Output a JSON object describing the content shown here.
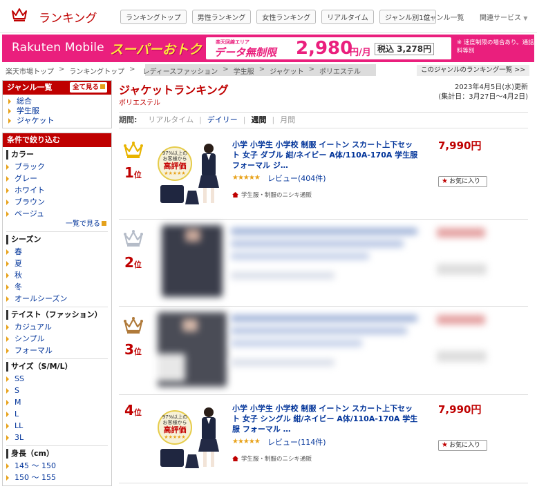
{
  "header": {
    "title": "ランキング",
    "tabs": [
      "ランキングトップ",
      "男性ランキング",
      "女性ランキング",
      "リアルタイム",
      "ジャンル別1位"
    ],
    "genre_list": "ジャンル一覧",
    "related": "関連サービス"
  },
  "banner": {
    "logo": "Rakuten Mobile",
    "headline": "スーパーおトク",
    "area": "楽天回線エリア",
    "data": "データ無制限",
    "price": "2,980",
    "unit": "円/月",
    "tax": "税込 3,278円",
    "note": "※ 速度制限の場合あり。通話料等別"
  },
  "breadcrumb": {
    "items": [
      "楽天市場トップ",
      "ランキングトップ",
      "レディースファッション",
      "学生服",
      "ジャケット",
      "ポリエステル"
    ],
    "right": "このジャンルのランキング一覧 >>"
  },
  "sidebar": {
    "genre_head": "ジャンル一覧",
    "all_btn": "全て見る",
    "genres": [
      "総合",
      "学生服",
      "ジャケット"
    ],
    "filter_head": "条件で絞り込む",
    "sections": [
      {
        "title": "カラー",
        "items": [
          "ブラック",
          "グレー",
          "ホワイト",
          "ブラウン",
          "ベージュ"
        ],
        "more": "一覧で見る"
      },
      {
        "title": "シーズン",
        "items": [
          "春",
          "夏",
          "秋",
          "冬",
          "オールシーズン"
        ]
      },
      {
        "title": "テイスト（ファッション）",
        "items": [
          "カジュアル",
          "シンプル",
          "フォーマル"
        ]
      },
      {
        "title": "サイズ（S/M/L）",
        "items": [
          "SS",
          "S",
          "M",
          "L",
          "LL",
          "3L"
        ]
      },
      {
        "title": "身長（cm）",
        "items": [
          "145 ～ 150",
          "150 ～ 155"
        ]
      }
    ]
  },
  "main": {
    "title": "ジャケットランキング",
    "subtitle": "ポリエステル",
    "updated": "2023年4月5日(水)更新",
    "period_range": "(集計日：3月27日～4月2日)",
    "period_label": "期間:",
    "periods": [
      "リアルタイム",
      "デイリー",
      "週間",
      "月間"
    ],
    "active_period": "週間"
  },
  "products": [
    {
      "rank": "1",
      "rank_suffix": "位",
      "name": "小学 小学生 小学校 制服 イートン スカート上下セット 女子 ダブル 紺/ネイビー A体/110A-170A 学生服 フォーマル ジ…",
      "price": "7,990円",
      "stars": "★★★★★",
      "rating": 4.5,
      "review": "レビュー(404件)",
      "shop": "学生服・制服のニシキ通販",
      "fav": "お気に入り",
      "badge_top": "97%以上の\nお客様から",
      "badge_main": "高評価",
      "crown_color": "#e8b400"
    },
    {
      "rank": "2",
      "rank_suffix": "位",
      "crown_color": "#b5bcc8"
    },
    {
      "rank": "3",
      "rank_suffix": "位",
      "crown_color": "#b07a3a"
    },
    {
      "rank": "4",
      "rank_suffix": "位",
      "name": "小学 小学生 小学校 制服 イートン スカート上下セット 女子 シングル 紺/ネイビー A体/110A-170A 学生服 フォーマル …",
      "price": "7,990円",
      "stars": "★★★★★",
      "rating": 4.5,
      "review": "レビュー(114件)",
      "shop": "学生服・制服のニシキ通販",
      "fav": "お気に入り",
      "badge_top": "97%以上の\nお客様から",
      "badge_main": "高評価"
    }
  ]
}
